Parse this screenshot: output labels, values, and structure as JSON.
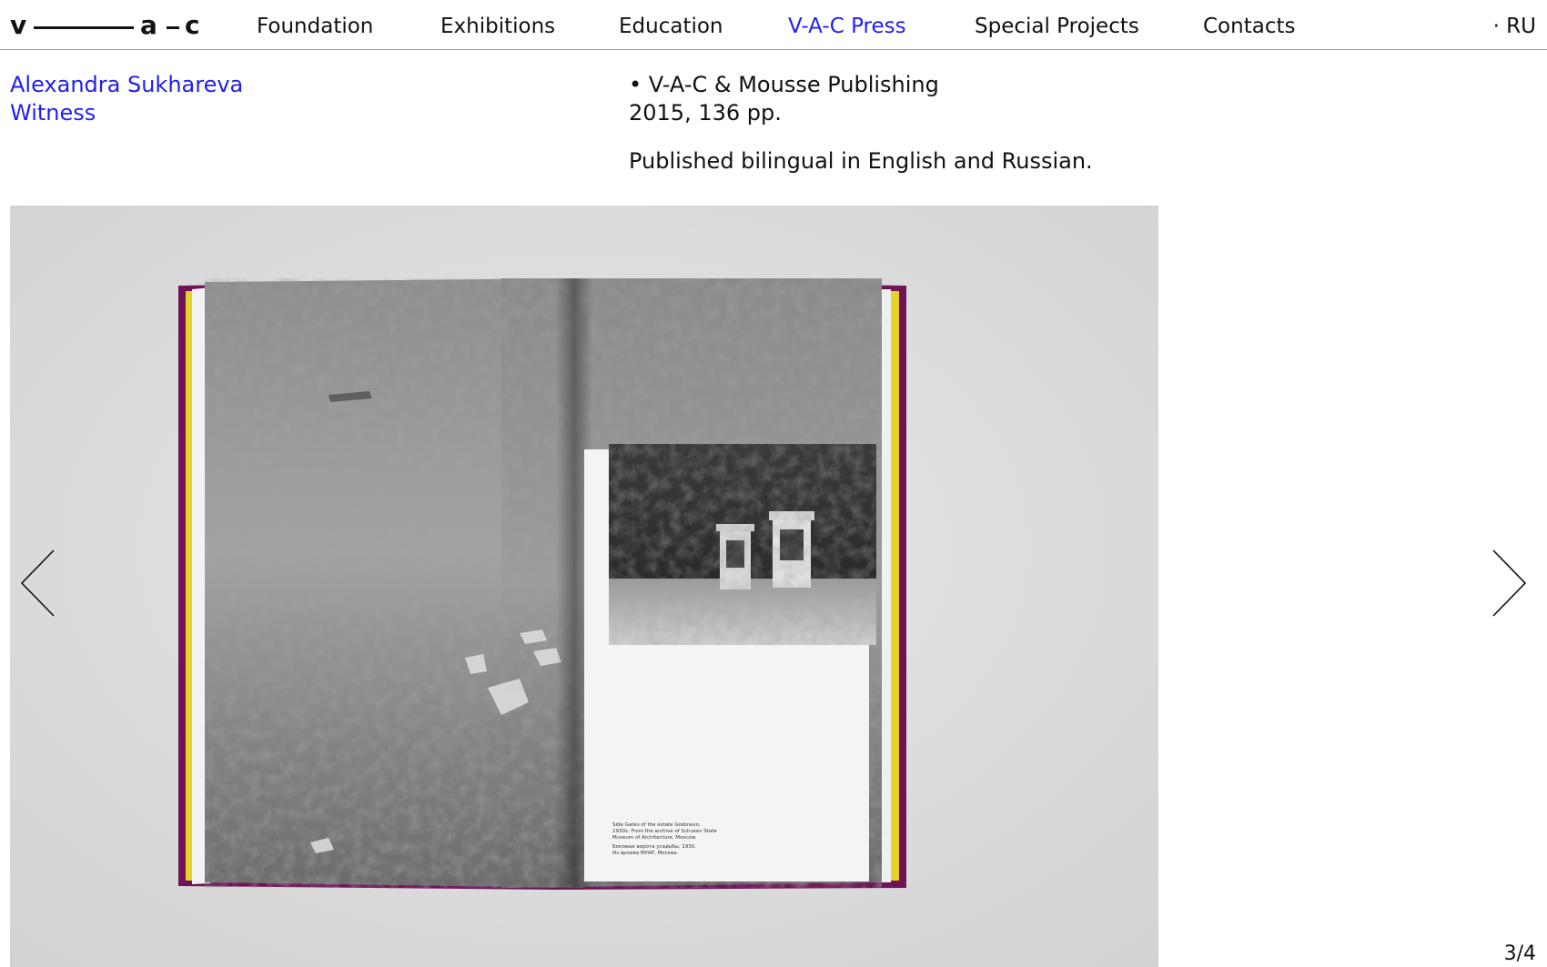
{
  "header": {
    "logo": {
      "v": "v",
      "a": "a",
      "c": "c"
    },
    "nav": [
      "Foundation",
      "Exhibitions",
      "Education",
      "V-A-C Press",
      "Special Projects",
      "Contacts"
    ],
    "active_nav": "V-A-C Press",
    "language": "· RU"
  },
  "book": {
    "author": "Alexandra Sukhareva",
    "title": "Witness",
    "publisher": "• V-A-C & Mousse Publishing",
    "year_pages": "2015, 136 pp.",
    "description": "Published bilingual in English and Russian.",
    "caption_en": [
      "Side Gates of the estate Grebnevo,",
      "1930s. From the archive of Schusev State",
      "Museum of Architecture, Moscow."
    ],
    "caption_ru": [
      "Боковые ворота усадьбы, 1930.",
      "Из архива МУАР, Москва."
    ]
  },
  "gallery": {
    "counter": "3/4",
    "prev_icon": "chevron-left-icon",
    "next_icon": "chevron-right-icon"
  },
  "colors": {
    "accent": "#1f1ff0",
    "book_cover": "#6e1457",
    "book_edge": "#e5d22a"
  }
}
